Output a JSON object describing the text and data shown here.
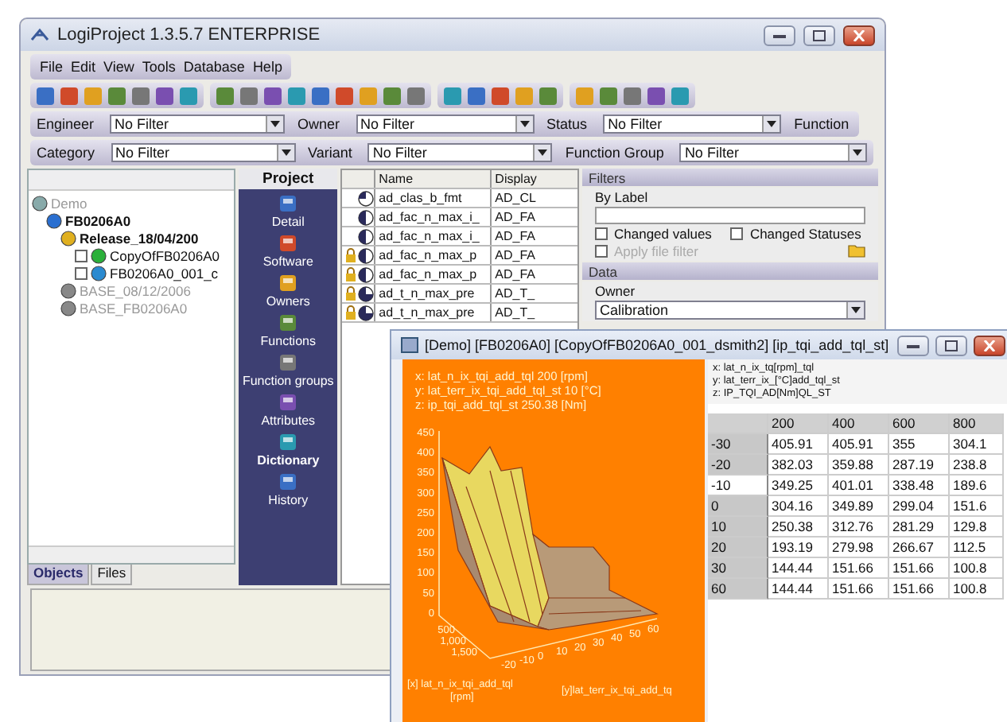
{
  "window": {
    "title": "LogiProject 1.3.5.7 ENTERPRISE"
  },
  "menu": [
    "File",
    "Edit",
    "View",
    "Tools",
    "Database",
    "Help"
  ],
  "filter_rows": [
    {
      "fields": [
        {
          "label": "Engineer",
          "value": "No Filter"
        },
        {
          "label": "Owner",
          "value": "No Filter"
        },
        {
          "label": "Status",
          "value": "No Filter"
        }
      ],
      "trailing_label": "Function"
    },
    {
      "fields": [
        {
          "label": "Category",
          "value": "No Filter"
        },
        {
          "label": "Variant",
          "value": "No Filter"
        },
        {
          "label": "Function Group",
          "value": "No Filter"
        }
      ]
    }
  ],
  "tree": [
    {
      "label": "Demo",
      "kind": "demo",
      "bold": false,
      "dimmed": true,
      "children": [
        {
          "label": "FB0206A0",
          "kind": "project",
          "bold": true,
          "dimmed": false,
          "children": [
            {
              "label": "Release_18/04/200",
              "kind": "release",
              "bold": true,
              "dimmed": false,
              "children": [
                {
                  "label": "CopyOfFB0206A0",
                  "kind": "green",
                  "bold": false,
                  "dimmed": false,
                  "checked": false
                },
                {
                  "label": "FB0206A0_001_c",
                  "kind": "blue",
                  "bold": false,
                  "dimmed": false,
                  "checked": false
                }
              ]
            },
            {
              "label": "BASE_08/12/2006",
              "kind": "base",
              "bold": false,
              "dimmed": true
            },
            {
              "label": "BASE_FB0206A0",
              "kind": "base",
              "bold": false,
              "dimmed": true
            }
          ]
        }
      ]
    }
  ],
  "left_tabs": [
    {
      "label": "Objects",
      "selected": true
    },
    {
      "label": "Files",
      "selected": false
    }
  ],
  "nav": {
    "title": "Project",
    "items": [
      {
        "label": "Detail",
        "selected": false
      },
      {
        "label": "Software",
        "selected": false
      },
      {
        "label": "Owners",
        "selected": false
      },
      {
        "label": "Functions",
        "selected": false
      },
      {
        "label": "Function groups",
        "selected": false
      },
      {
        "label": "Attributes",
        "selected": false
      },
      {
        "label": "Dictionary",
        "selected": true
      },
      {
        "label": "History",
        "selected": false
      }
    ]
  },
  "table": {
    "columns": [
      "Name",
      "Display"
    ],
    "rows": [
      {
        "kind": "quarter",
        "locked": false,
        "name": "ad_clas_b_fmt",
        "display": "AD_CL"
      },
      {
        "kind": "half",
        "locked": false,
        "name": "ad_fac_n_max_i_",
        "display": "AD_FA"
      },
      {
        "kind": "half",
        "locked": false,
        "name": "ad_fac_n_max_i_",
        "display": "AD_FA"
      },
      {
        "kind": "half",
        "locked": true,
        "name": "ad_fac_n_max_p",
        "display": "AD_FA"
      },
      {
        "kind": "half",
        "locked": true,
        "name": "ad_fac_n_max_p",
        "display": "AD_FA"
      },
      {
        "kind": "three_quarter",
        "locked": true,
        "name": "ad_t_n_max_pre",
        "display": "AD_T_"
      },
      {
        "kind": "three_quarter",
        "locked": true,
        "name": "ad_t_n_max_pre",
        "display": "AD_T_"
      }
    ]
  },
  "filters": {
    "title": "Filters",
    "by_label": "By Label",
    "checks": [
      {
        "label": "Changed values",
        "checked": false,
        "disabled": false
      },
      {
        "label": "Changed Statuses",
        "checked": false,
        "disabled": false
      },
      {
        "label": "Apply file filter",
        "checked": false,
        "disabled": true
      }
    ]
  },
  "data_panel": {
    "title": "Data",
    "owner_label": "Owner",
    "owner_value": "Calibration"
  },
  "editor": {
    "title": "[Demo] [FB0206A0] [CopyOfFB0206A0_001_dsmith2] [ip_tqi_add_tql_st]",
    "plot": {
      "info": [
        "x: lat_n_ix_tqi_add_tql 200 [rpm]",
        "y: lat_terr_ix_tqi_add_tql_st 10 [°C]",
        "z: ip_tqi_add_tql_st 250.38 [Nm]"
      ],
      "z_ticks": [
        "450",
        "400",
        "350",
        "300",
        "250",
        "200",
        "150",
        "100",
        "50",
        "0"
      ],
      "x_ticks": [
        "500",
        "1,000",
        "1,500"
      ],
      "y_ticks": [
        "-20",
        "-10",
        "0",
        "10",
        "20",
        "30",
        "40",
        "50",
        "60"
      ],
      "x_label": "[x] lat_n_ix_tqi_add_tql",
      "x_unit": "[rpm]",
      "y_label": "[y]lat_terr_ix_tqi_add_tq"
    },
    "map_info": [
      "x: lat_n_ix_tq[rpm]_tql",
      "y: lat_terr_ix_[°C]add_tql_st",
      "z: IP_TQI_AD[Nm]QL_ST"
    ],
    "columns": [
      "200",
      "400",
      "600",
      "800"
    ],
    "rows": [
      {
        "label": "-30",
        "selected": false,
        "cells": [
          "405.91",
          "405.91",
          "355",
          "304.1"
        ]
      },
      {
        "label": "-20",
        "selected": false,
        "cells": [
          "382.03",
          "359.88",
          "287.19",
          "238.8"
        ]
      },
      {
        "label": "-10",
        "selected": true,
        "cells": [
          "349.25",
          "401.01",
          "338.48",
          "189.6"
        ]
      },
      {
        "label": "0",
        "selected": false,
        "cells": [
          "304.16",
          "349.89",
          "299.04",
          "151.6"
        ]
      },
      {
        "label": "10",
        "selected": false,
        "cells": [
          "250.38",
          "312.76",
          "281.29",
          "129.8"
        ]
      },
      {
        "label": "20",
        "selected": false,
        "cells": [
          "193.19",
          "279.98",
          "266.67",
          "112.5"
        ]
      },
      {
        "label": "30",
        "selected": false,
        "cells": [
          "144.44",
          "151.66",
          "151.66",
          "100.8"
        ]
      },
      {
        "label": "60",
        "selected": false,
        "cells": [
          "144.44",
          "151.66",
          "151.66",
          "100.8"
        ]
      }
    ]
  }
}
